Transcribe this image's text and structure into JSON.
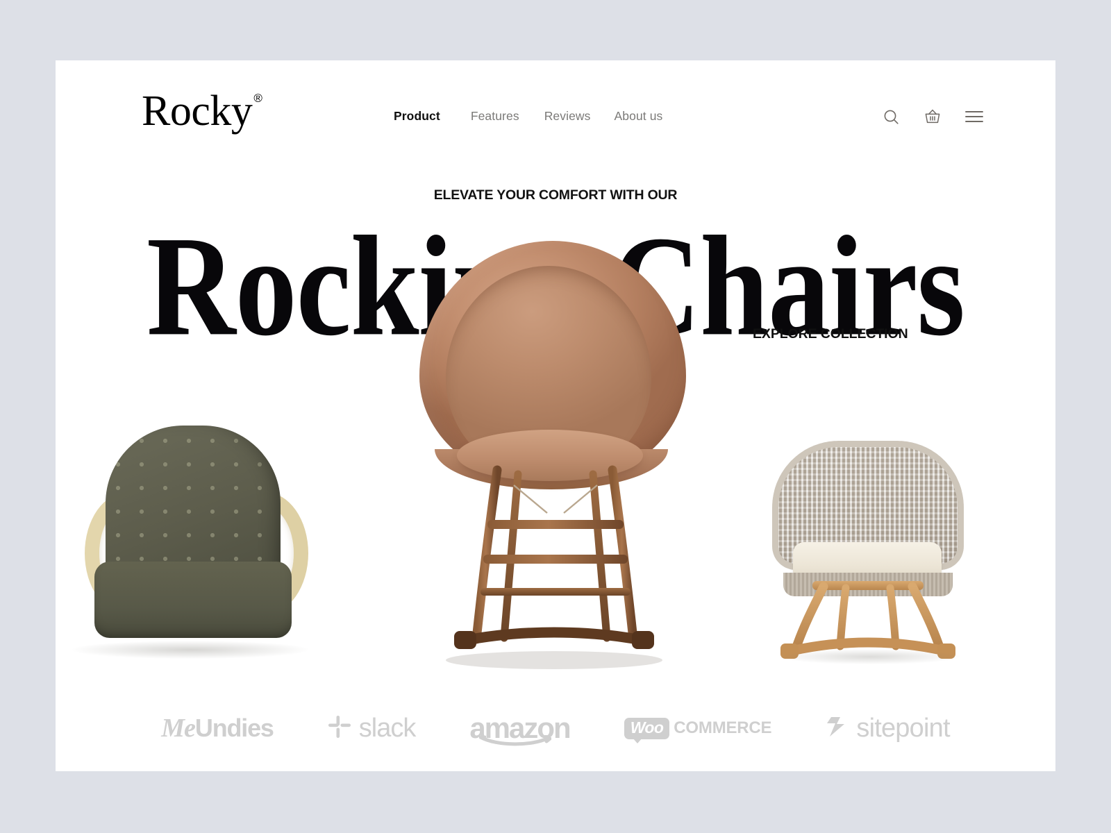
{
  "page": {
    "background_color": "#dde0e7",
    "card_background": "#ffffff"
  },
  "header": {
    "logo": {
      "word": "Rocky",
      "registered_mark": "®"
    },
    "nav": [
      {
        "label": "Product",
        "active": true
      },
      {
        "label": "Features",
        "active": false
      },
      {
        "label": "Reviews",
        "active": false
      },
      {
        "label": "About us",
        "active": false
      }
    ],
    "icons": [
      {
        "name": "search-icon",
        "label": "Search"
      },
      {
        "name": "basket-icon",
        "label": "Cart"
      },
      {
        "name": "hamburger-menu-icon",
        "label": "Menu"
      }
    ]
  },
  "hero": {
    "eyebrow": "ELEVATE YOUR COMFORT WITH OUR",
    "headline": "Rocking Chairs",
    "cta_label": "EXPLORE COLLECTION"
  },
  "products": [
    {
      "name": "olive-fabric-rocking-chair",
      "position": "left",
      "shell_color": "#5d5d4c",
      "frame_color": "#e0d3a8"
    },
    {
      "name": "tan-leather-rocking-chair",
      "position": "center",
      "shell_color": "#c08b6b",
      "frame_color": "#7a4f2c"
    },
    {
      "name": "woven-rope-rocking-chair",
      "position": "right",
      "shell_color": "#bcb3a6",
      "frame_color": "#c89a63"
    }
  ],
  "brands": [
    {
      "name": "meundies",
      "part1": "Me",
      "part2": "Undies"
    },
    {
      "name": "slack",
      "word": "slack"
    },
    {
      "name": "amazon",
      "word": "amazon"
    },
    {
      "name": "woocommerce",
      "badge": "Woo",
      "word": "COMMERCE"
    },
    {
      "name": "sitepoint",
      "word": "sitepoint"
    }
  ],
  "colors": {
    "text_dark": "#101010",
    "text_muted": "#7b7a78",
    "icon": "#6f6a65",
    "brand_logo": "#cfcfcf"
  }
}
